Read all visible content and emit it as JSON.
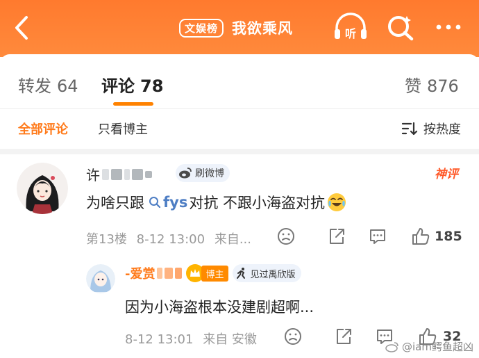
{
  "header": {
    "tag": "文娱榜",
    "title": "我欲乘风",
    "listen_label": "听"
  },
  "tabs": [
    {
      "label": "转发",
      "count": "64"
    },
    {
      "label": "评论",
      "count": "78"
    },
    {
      "label": "赞",
      "count": "876"
    }
  ],
  "filters": {
    "all": "全部评论",
    "owner_only": "只看博主",
    "sort": "按热度"
  },
  "comment": {
    "user_prefix": "许",
    "badge": "刷微博",
    "top_badge": "神评",
    "text_before": "为啥只跟",
    "link": "fys",
    "text_after": "对抗 不跟小海盗对抗",
    "floor": "第13楼",
    "time": "8-12 13:00",
    "location": "来自...",
    "likes": "185"
  },
  "reply": {
    "user_prefix": "-爱赏",
    "owner_badge": "博主",
    "verified_badge": "见过禹欣版",
    "text": "因为小海盗根本没建剧超啊...",
    "time": "8-12 13:01",
    "location": "来自 安徽",
    "likes": "32"
  },
  "watermark": "@iam鳄鱼超凶",
  "colors": {
    "header": "#ff7a2e",
    "accent": "#ff8200",
    "link": "#4e7ec4"
  }
}
